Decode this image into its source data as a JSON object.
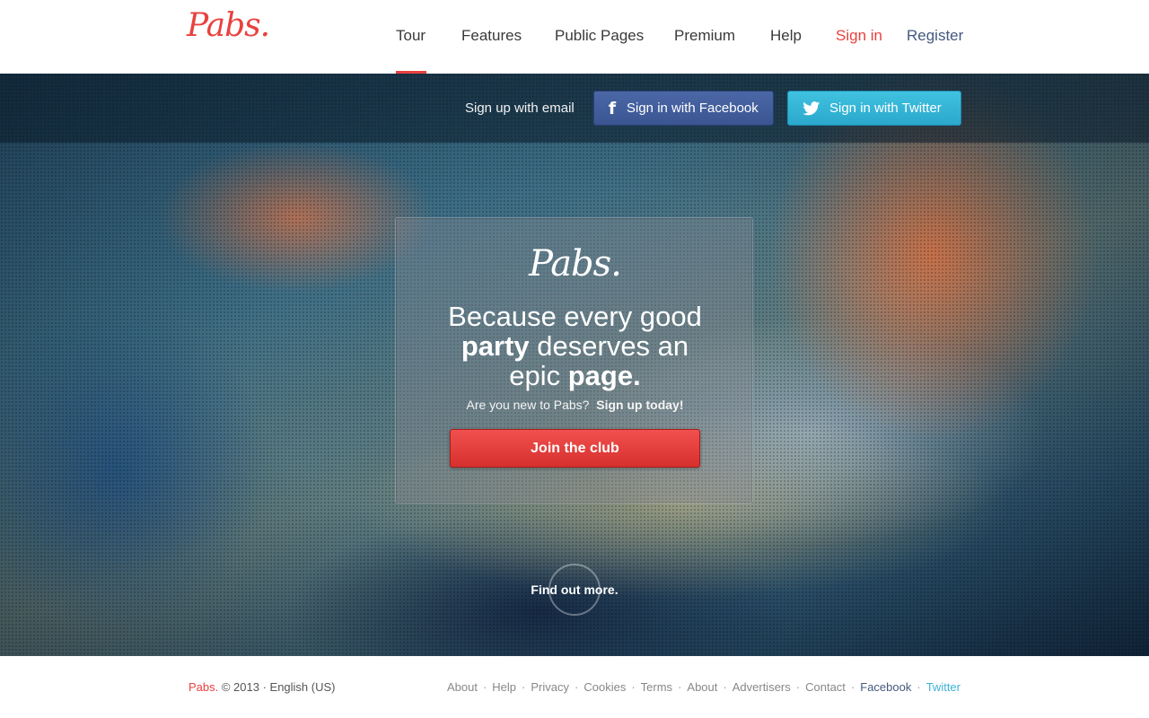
{
  "brand": {
    "logo": "Pabs."
  },
  "nav": {
    "items": [
      "Tour",
      "Features",
      "Public Pages",
      "Premium",
      "Help"
    ],
    "signin": "Sign in",
    "register": "Register"
  },
  "social": {
    "signup_email": "Sign up with email",
    "facebook": "Sign in with Facebook",
    "twitter": "Sign in with Twitter"
  },
  "promo": {
    "logo": "Pabs.",
    "tagline_1": "Because every good",
    "tagline_2a": "party",
    "tagline_2b": " deserves an",
    "tagline_3a": "epic ",
    "tagline_3b": "page.",
    "question": "Are you new to Pabs?",
    "question_cta": "Sign up today!",
    "join_button": "Join the club"
  },
  "find_more": "Find out more.",
  "footer": {
    "brand": "Pabs.",
    "copyright": " © 2013 · English (US)",
    "links": [
      "About",
      "Help",
      "Privacy",
      "Cookies",
      "Terms",
      "About",
      "Advertisers",
      "Contact"
    ],
    "facebook": "Facebook",
    "twitter": "Twitter"
  },
  "colors": {
    "accent": "#e8413f",
    "facebook": "#3a5592",
    "twitter": "#2ba8cc",
    "register": "#44597e"
  }
}
